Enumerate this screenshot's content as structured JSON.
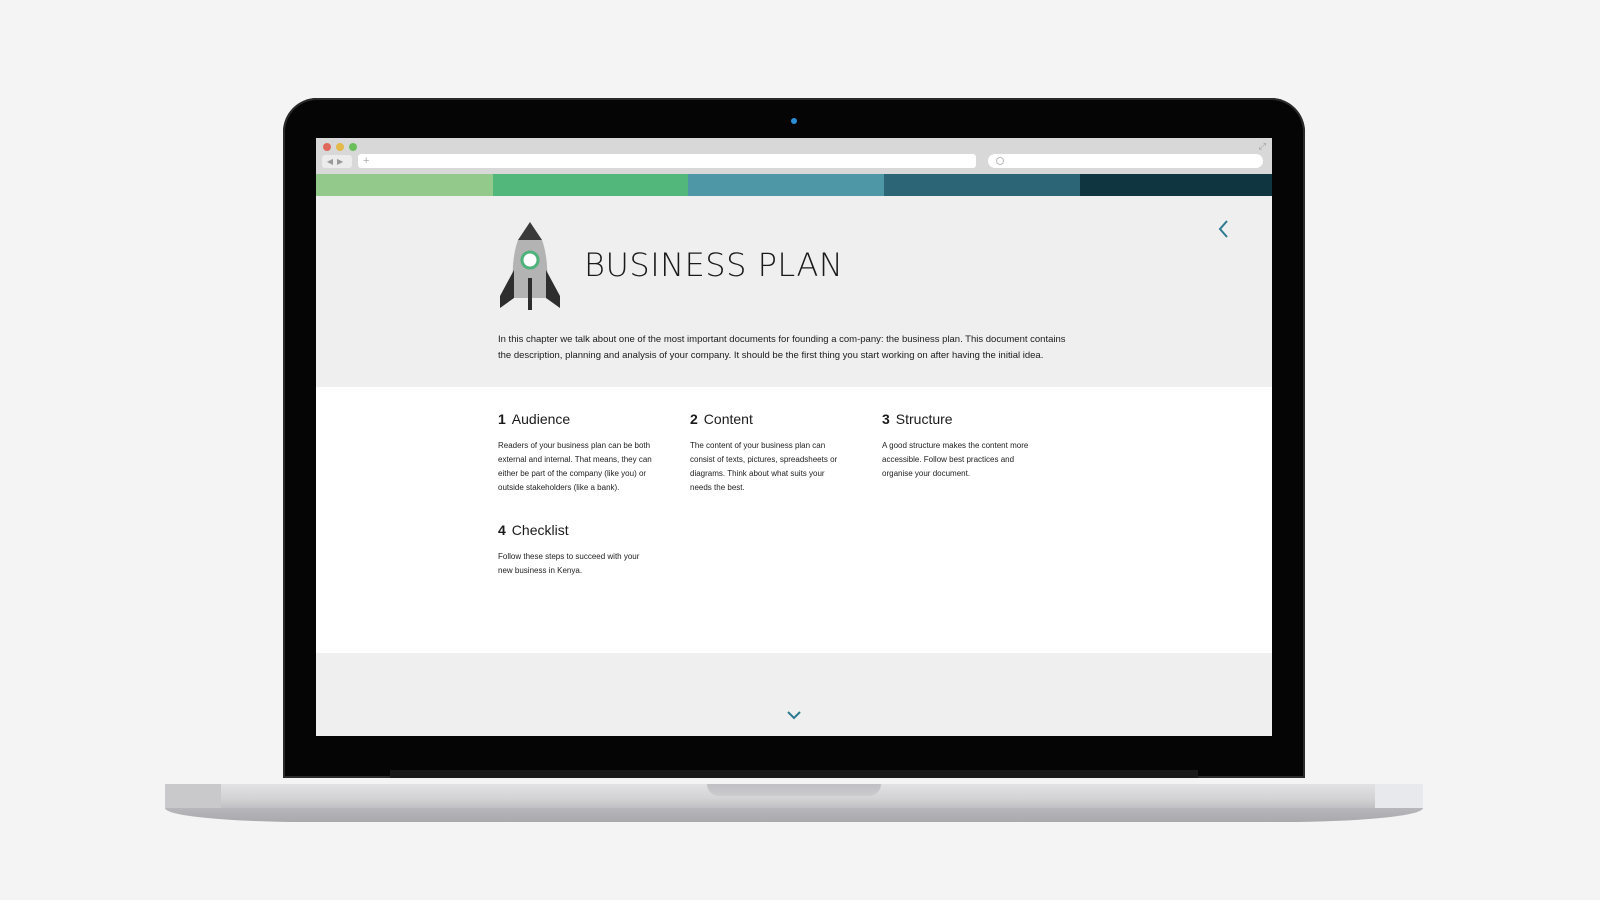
{
  "page": {
    "title": "BUSINESS PLAN",
    "intro_line1": "In this chapter we talk about one of the most important documents for founding a com-pany: the business plan. This document contains",
    "intro_line2": "the description, planning and analysis of your company. It should be the first thing you start working on after having the initial idea."
  },
  "colors": {
    "bar": [
      "#94c98c",
      "#51b77a",
      "#4e97a7",
      "#2c6676",
      "#0f3541"
    ],
    "accent": "#2b7a8f"
  },
  "sections": [
    {
      "number": "1",
      "title": "Audience",
      "lines": [
        "Readers of your business plan can be both",
        "external and internal. That means, they can",
        "either be part of the company (like you) or",
        "outside stakeholders (like a bank)."
      ]
    },
    {
      "number": "2",
      "title": "Content",
      "lines": [
        "The content of your business plan can",
        "consist of texts, pictures, spreadsheets or",
        "diagrams. Think about what suits your",
        "needs the best."
      ]
    },
    {
      "number": "3",
      "title": "Structure",
      "lines": [
        "A good structure makes the content more",
        "accessible. Follow best practices and",
        "organise your document."
      ]
    },
    {
      "number": "4",
      "title": "Checklist",
      "lines": [
        "Follow these steps to succeed with your",
        "new business in Kenya."
      ]
    }
  ],
  "icons": {
    "hero": "rocket-icon",
    "back": "chevron-left-icon",
    "scroll": "chevron-down-icon"
  }
}
